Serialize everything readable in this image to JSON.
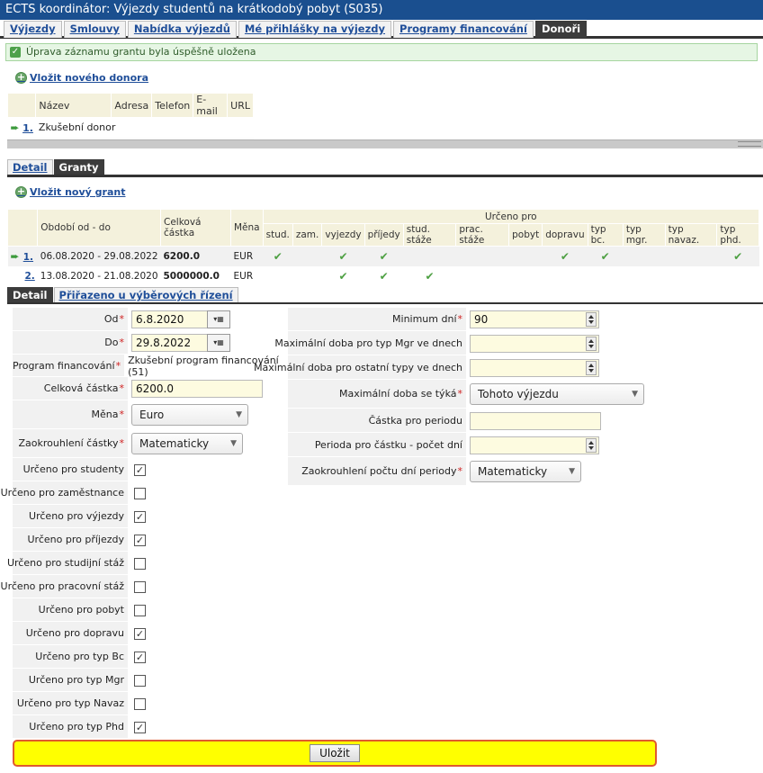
{
  "window": {
    "title": "ECTS koordinátor: Výjezdy studentů na krátkodobý pobyt (S035)"
  },
  "main_tabs": [
    {
      "label": "Výjezdy",
      "active": false
    },
    {
      "label": "Smlouvy",
      "active": false
    },
    {
      "label": "Nabídka výjezdů",
      "active": false
    },
    {
      "label": "Mé přihlášky na výjezdy",
      "active": false
    },
    {
      "label": "Programy financování",
      "active": false
    },
    {
      "label": "Donoři",
      "active": true
    }
  ],
  "message": {
    "text": "Úprava záznamu grantu byla úspěšně uložena"
  },
  "donor_section": {
    "add_link": "Vložit nového donora",
    "headers": [
      "Název",
      "Adresa",
      "Telefon",
      "E-mail",
      "URL"
    ],
    "rows": [
      {
        "num": "1.",
        "name": "Zkušební donor"
      }
    ]
  },
  "donor_tabs": [
    {
      "label": "Detail",
      "active": false
    },
    {
      "label": "Granty",
      "active": true
    }
  ],
  "grant_section": {
    "add_link": "Vložit nový grant",
    "headers": {
      "period": "Období od - do",
      "amount": "Celková částka",
      "currency": "Měna",
      "group": "Určeno pro"
    },
    "sub_headers": [
      "stud.",
      "zam.",
      "vyjezdy",
      "příjedy",
      "stud. stáže",
      "prac. stáže",
      "pobyt",
      "dopravu",
      "typ bc.",
      "typ mgr.",
      "typ navaz.",
      "typ phd."
    ],
    "rows": [
      {
        "num": "1.",
        "period": "06.08.2020 - 29.08.2022",
        "amount": "6200.0",
        "currency": "EUR",
        "selected": true,
        "flags": [
          true,
          false,
          true,
          true,
          false,
          false,
          false,
          true,
          true,
          false,
          false,
          true
        ]
      },
      {
        "num": "2.",
        "period": "13.08.2020 - 21.08.2020",
        "amount": "5000000.0",
        "currency": "EUR",
        "selected": false,
        "flags": [
          false,
          false,
          true,
          true,
          true,
          false,
          false,
          false,
          false,
          false,
          false,
          false
        ]
      }
    ]
  },
  "grant_tabs": [
    {
      "label": "Detail",
      "active": true
    },
    {
      "label": "Přiřazeno u výběrových řízení",
      "active": false
    }
  ],
  "form": {
    "od_label": "Od",
    "od_value": "6.8.2020",
    "do_label": "Do",
    "do_value": "29.8.2022",
    "program_label": "Program financování",
    "program_value": "Zkušební program financování (51)",
    "amount_label": "Celková částka",
    "amount_value": "6200.0",
    "currency_label": "Měna",
    "currency_value": "Euro",
    "rounding_label": "Zaokrouhlení částky",
    "rounding_value": "Matematicky",
    "checkboxes": [
      {
        "label": "Určeno pro studenty",
        "checked": true
      },
      {
        "label": "Určeno pro zaměstnance",
        "checked": false
      },
      {
        "label": "Určeno pro výjezdy",
        "checked": true
      },
      {
        "label": "Určeno pro příjezdy",
        "checked": true
      },
      {
        "label": "Určeno pro studijní stáž",
        "checked": false
      },
      {
        "label": "Určeno pro pracovní stáž",
        "checked": false
      },
      {
        "label": "Určeno pro pobyt",
        "checked": false
      },
      {
        "label": "Určeno pro dopravu",
        "checked": true
      },
      {
        "label": "Určeno pro typ Bc",
        "checked": true
      },
      {
        "label": "Určeno pro typ Mgr",
        "checked": false
      },
      {
        "label": "Určeno pro typ Navaz",
        "checked": false
      },
      {
        "label": "Určeno pro typ Phd",
        "checked": true
      }
    ],
    "min_days_label": "Minimum dní",
    "min_days_value": "90",
    "max_mgr_label": "Maximální doba pro typ Mgr ve dnech",
    "max_mgr_value": "",
    "max_other_label": "Maximální doba pro ostatní typy ve dnech",
    "max_other_value": "",
    "max_applies_label": "Maximální doba se týká",
    "max_applies_value": "Tohoto výjezdu",
    "period_amount_label": "Částka pro periodu",
    "period_amount_value": "",
    "period_days_label": "Perioda pro částku - počet dní",
    "period_days_value": "",
    "period_rounding_label": "Zaokrouhlení počtu dní periody",
    "period_rounding_value": "Matematicky"
  },
  "actions": {
    "save_label": "Uložit"
  },
  "icons": {
    "check": "check-icon",
    "plus": "plus-circle-icon",
    "arrow": "arrow-right-icon"
  },
  "colors": {
    "title_bar": "#1a4f8f",
    "accent_link": "#1f4e99",
    "save_bar": "#ffff00",
    "save_border": "#e05a2e",
    "success_bg": "#e6f6e4"
  }
}
